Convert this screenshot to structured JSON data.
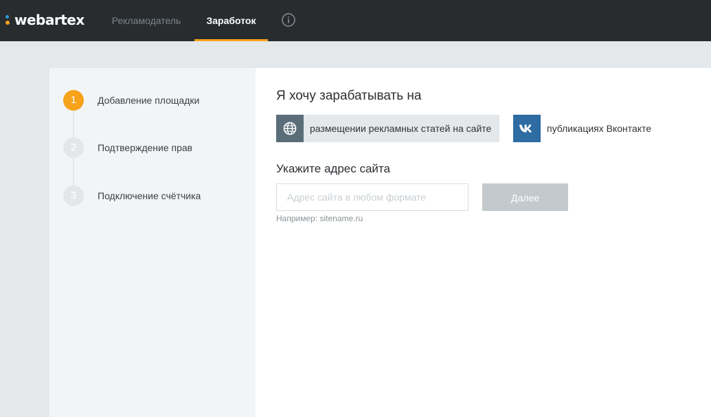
{
  "app": {
    "logo_text": "webartex"
  },
  "nav": {
    "tabs": [
      {
        "label": "Рекламодатель",
        "active": false
      },
      {
        "label": "Заработок",
        "active": true
      }
    ],
    "info_icon": "info-circle-icon"
  },
  "steps": [
    {
      "number": "1",
      "label": "Добавление площадки",
      "active": true
    },
    {
      "number": "2",
      "label": "Подтверждение прав",
      "active": false
    },
    {
      "number": "3",
      "label": "Подключение счётчика",
      "active": false
    }
  ],
  "main": {
    "heading": "Я хочу зарабатывать на",
    "options": [
      {
        "label": "размещении рекламных статей на сайте",
        "icon": "globe-icon",
        "selected": true
      },
      {
        "label": "публикациях Вконтакте",
        "icon": "vk-icon",
        "selected": false
      }
    ],
    "address_heading": "Укажите адрес сайта",
    "address_input": {
      "value": "",
      "placeholder": "Адрес сайта в любом формате"
    },
    "hint": "Например: sitename.ru",
    "next_label": "Далее"
  },
  "colors": {
    "topbar": "#282c2f",
    "accent": "#f7a21b",
    "logo_blue": "#2c9bd6",
    "globe_box": "#5a6e7a",
    "vk_box": "#2e6ca3",
    "button_disabled": "#c3c9cd"
  }
}
